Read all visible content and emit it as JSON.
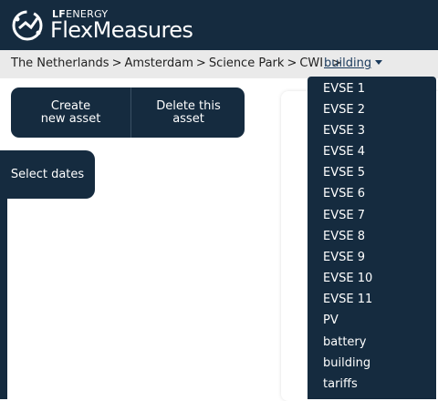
{
  "header": {
    "brand_small_bold": "LF",
    "brand_small_thin": "ENERGY",
    "brand_title": "FlexMeasures",
    "logo_icon": "flexmeasures-logo-icon"
  },
  "breadcrumb": {
    "items": [
      "The Netherlands",
      "Amsterdam",
      "Science Park",
      "CWI"
    ],
    "separator": ">",
    "current": "building"
  },
  "actions": {
    "create_label_1": "Create",
    "create_label_2": "new asset",
    "delete_label_1": "Delete this",
    "delete_label_2": "asset"
  },
  "dates": {
    "select_label": "Select dates"
  },
  "dropdown": {
    "items": [
      "EVSE 1",
      "EVSE 2",
      "EVSE 3",
      "EVSE 4",
      "EVSE 5",
      "EVSE 6",
      "EVSE 7",
      "EVSE 8",
      "EVSE 9",
      "EVSE 10",
      "EVSE 11",
      "PV",
      "battery",
      "building",
      "tariffs"
    ]
  },
  "colors": {
    "primary": "#152b3f",
    "crumb_bg": "#eaeaea"
  }
}
